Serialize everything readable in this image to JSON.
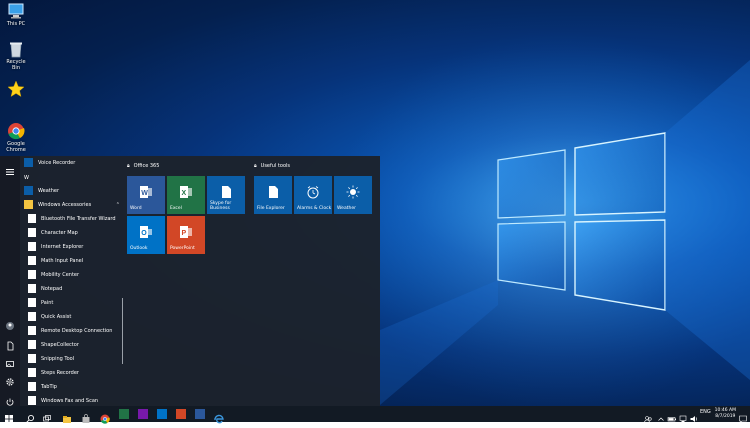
{
  "desktop": {
    "icons": [
      {
        "label": "This PC"
      },
      {
        "label": "Recycle Bin"
      },
      {
        "label": ""
      },
      {
        "label": "Google Chrome"
      }
    ]
  },
  "start_menu": {
    "apps": [
      {
        "label": "Voice Recorder"
      },
      {
        "label": "W"
      },
      {
        "label": "Weather"
      },
      {
        "label": "Windows Accessories"
      },
      {
        "label": "Bluetooth File Transfer Wizard"
      },
      {
        "label": "Character Map"
      },
      {
        "label": "Internet Explorer"
      },
      {
        "label": "Math Input Panel"
      },
      {
        "label": "Mobility Center"
      },
      {
        "label": "Notepad"
      },
      {
        "label": "Paint"
      },
      {
        "label": "Quick Assist"
      },
      {
        "label": "Remote Desktop Connection"
      },
      {
        "label": "ShapeCollector"
      },
      {
        "label": "Snipping Tool"
      },
      {
        "label": "Steps Recorder"
      },
      {
        "label": "TabTip"
      },
      {
        "label": "Windows Fax and Scan"
      }
    ],
    "groups": [
      {
        "title": "Office 365",
        "tiles": [
          {
            "label": "Word",
            "color": "#2b579a"
          },
          {
            "label": "Excel",
            "color": "#217346"
          },
          {
            "label": "Skype for Business",
            "color": "#0b5ea8"
          },
          {
            "label": "Outlook",
            "color": "#0072c6"
          },
          {
            "label": "PowerPoint",
            "color": "#d24726"
          }
        ]
      },
      {
        "title": "Useful tools",
        "tiles": [
          {
            "label": "File Explorer",
            "color": "#0b5ea8"
          },
          {
            "label": "Alarms & Clock",
            "color": "#0b5ea8"
          },
          {
            "label": "Weather",
            "color": "#0b5ea8"
          }
        ]
      }
    ]
  },
  "taskbar": {
    "tray_lang": "ENG",
    "clock_time": "10:46 AM",
    "clock_date": "8/7/2019"
  }
}
